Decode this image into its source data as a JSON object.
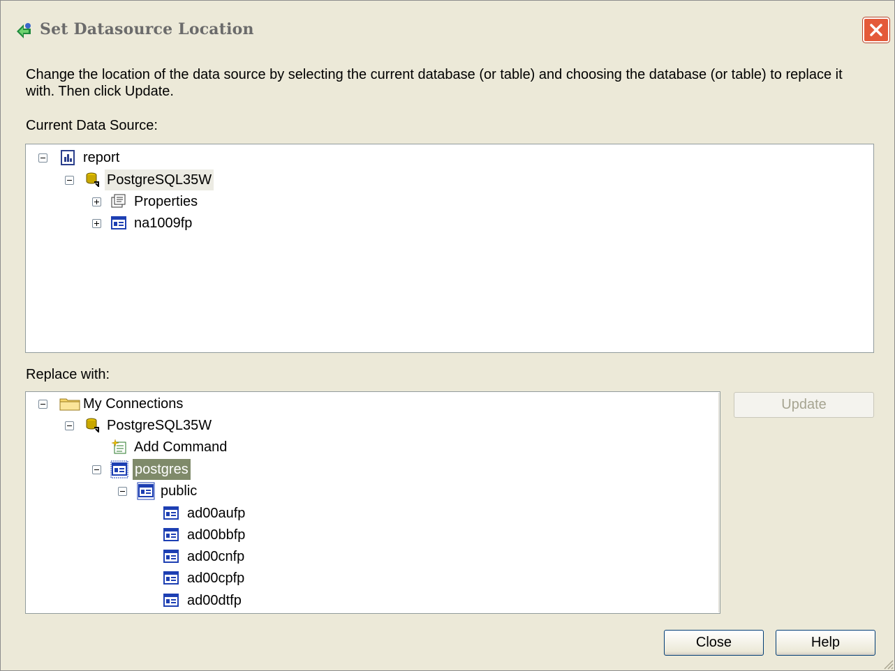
{
  "window": {
    "title": "Set Datasource Location"
  },
  "description": "Change the location of the data source by selecting the current database (or table) and choosing the database (or table) to replace it with.  Then click Update.",
  "current_label": "Current Data Source:",
  "current_tree": [
    {
      "label": "report",
      "icon": "report-icon",
      "expander": "minus"
    },
    {
      "label": "PostgreSQL35W",
      "icon": "database-connection-icon",
      "expander": "minus"
    },
    {
      "label": "Properties",
      "icon": "properties-icon",
      "expander": "plus"
    },
    {
      "label": "na1009fp",
      "icon": "table-icon",
      "expander": "plus"
    }
  ],
  "replace_label": "Replace with:",
  "replace_tree": [
    {
      "label": "My Connections",
      "icon": "folder-icon",
      "expander": "minus"
    },
    {
      "label": "PostgreSQL35W",
      "icon": "database-connection-icon",
      "expander": "minus"
    },
    {
      "label": "Add Command",
      "icon": "add-command-icon",
      "expander": "none"
    },
    {
      "label": "postgres",
      "icon": "table-icon",
      "expander": "minus",
      "selected": true
    },
    {
      "label": "public",
      "icon": "table-icon",
      "expander": "minus"
    },
    {
      "label": "ad00aufp",
      "icon": "table-icon",
      "expander": "none"
    },
    {
      "label": "ad00bbfp",
      "icon": "table-icon",
      "expander": "none"
    },
    {
      "label": "ad00cnfp",
      "icon": "table-icon",
      "expander": "none"
    },
    {
      "label": "ad00cpfp",
      "icon": "table-icon",
      "expander": "none"
    },
    {
      "label": "ad00dtfp",
      "icon": "table-icon",
      "expander": "none"
    }
  ],
  "buttons": {
    "update": "Update",
    "close": "Close",
    "help": "Help"
  },
  "colors": {
    "selection": "#7f8a6a",
    "dialog_bg": "#ece9d8",
    "close_button": "#e45a3a"
  }
}
